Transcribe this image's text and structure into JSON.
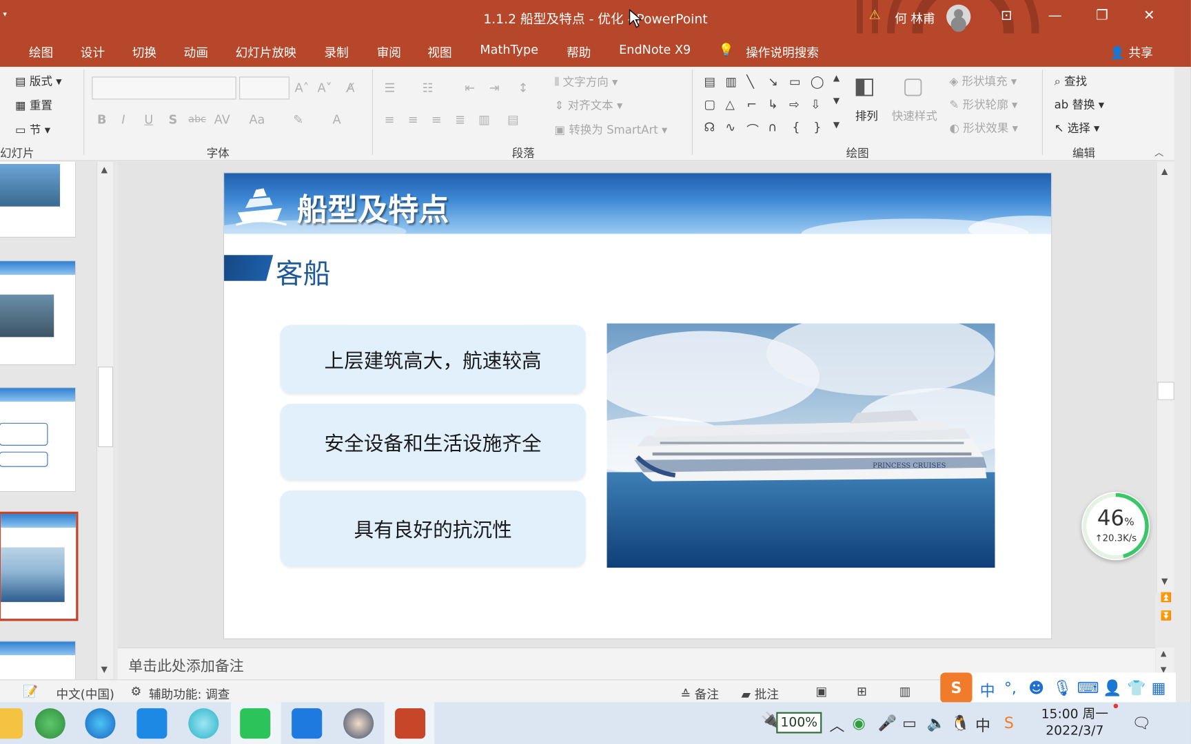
{
  "window": {
    "title": "1.1.2 船型及特点 - 优化  -  PowerPoint",
    "user_name": "何 林甫",
    "controls": [
      "restore-ribbon",
      "minimize",
      "maximize",
      "close"
    ]
  },
  "ribbon_tabs": [
    "绘图",
    "设计",
    "切换",
    "动画",
    "幻灯片放映",
    "录制",
    "审阅",
    "视图",
    "MathType",
    "帮助",
    "EndNote X9",
    "操作说明搜索"
  ],
  "share_label": "共享",
  "ribbon": {
    "slides_group": {
      "label": "幻灯片",
      "layout": "版式",
      "reset": "重置",
      "section": "节"
    },
    "font_group": {
      "label": "字体",
      "bold": "B",
      "italic": "I",
      "underline": "U",
      "shadow": "S",
      "strike": "abc",
      "spacing": "AV",
      "case": "Aa"
    },
    "paragraph_group": {
      "label": "段落",
      "text_direction": "文字方向",
      "align_text": "对齐文本",
      "smartart": "转换为 SmartArt"
    },
    "drawing_group": {
      "label": "绘图",
      "arrange": "排列",
      "quick_styles": "快速样式",
      "shape_fill": "形状填充",
      "shape_outline": "形状轮廓",
      "shape_effects": "形状效果"
    },
    "editing_group": {
      "label": "编辑",
      "find": "查找",
      "replace": "替换",
      "select": "选择"
    }
  },
  "slide": {
    "title": "船型及特点",
    "subtitle": "客船",
    "points": [
      "上层建筑高大，航速较高",
      "安全设备和生活设施齐全",
      "具有良好的抗沉性"
    ],
    "photo_text": "PRINCESS CRUISES"
  },
  "notes_placeholder": "单击此处添加备注",
  "status": {
    "language": "中文(中国)",
    "accessibility": "辅助功能: 调查",
    "notes": "备注",
    "comments": "批注"
  },
  "net_widget": {
    "percent": "46",
    "percent_sign": "%",
    "speed": "↑20.3K/s"
  },
  "taskbar": {
    "battery": "100%",
    "time": "15:00 周一",
    "date": "2022/3/7"
  },
  "ime": {
    "mode": "中",
    "punct": "°,"
  }
}
